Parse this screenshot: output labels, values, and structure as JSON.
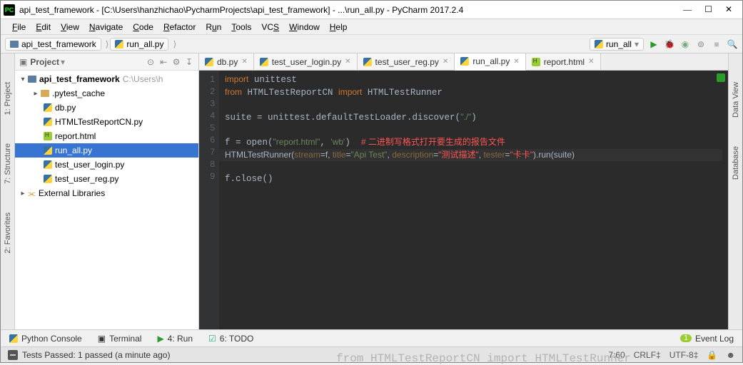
{
  "title": "api_test_framework - [C:\\Users\\hanzhichao\\PycharmProjects\\api_test_framework] - ...\\run_all.py - PyCharm 2017.2.4",
  "menu": [
    "File",
    "Edit",
    "View",
    "Navigate",
    "Code",
    "Refactor",
    "Run",
    "Tools",
    "VCS",
    "Window",
    "Help"
  ],
  "crumbs": {
    "root": "api_test_framework",
    "file": "run_all.py"
  },
  "run_config": "run_all",
  "left_rail": [
    "1: Project",
    "7: Structure",
    "2: Favorites"
  ],
  "right_rail": [
    "Data View",
    "Database"
  ],
  "project_panel_label": "Project",
  "tree": {
    "root": {
      "name": "api_test_framework",
      "path": "C:\\Users\\h"
    },
    "children": [
      {
        "name": ".pytest_cache",
        "kind": "dir"
      },
      {
        "name": "db.py",
        "kind": "py"
      },
      {
        "name": "HTMLTestReportCN.py",
        "kind": "py"
      },
      {
        "name": "report.html",
        "kind": "html"
      },
      {
        "name": "run_all.py",
        "kind": "py",
        "selected": true
      },
      {
        "name": "test_user_login.py",
        "kind": "py"
      },
      {
        "name": "test_user_reg.py",
        "kind": "py"
      }
    ],
    "ext_lib": "External Libraries"
  },
  "tabs": [
    {
      "name": "db.py",
      "kind": "py"
    },
    {
      "name": "test_user_login.py",
      "kind": "py"
    },
    {
      "name": "test_user_reg.py",
      "kind": "py"
    },
    {
      "name": "run_all.py",
      "kind": "py",
      "active": true
    },
    {
      "name": "report.html",
      "kind": "html"
    }
  ],
  "code_lines": [
    "1",
    "2",
    "3",
    "4",
    "5",
    "6",
    "7",
    "8",
    "9"
  ],
  "code": {
    "l1": "import unittest",
    "l2": "from HTMLTestReportCN import HTMLTestRunner",
    "l3": "",
    "l4": "suite = unittest.defaultTestLoader.discover(\"./\")",
    "l5": "",
    "l6a": "f = open(",
    "l6b": "\"report.html\"",
    "l6c": ", ",
    "l6d": "'wb'",
    "l6e": ")  ",
    "l6f": "# 二进制写格式打开要生成的报告文件",
    "l7a": "HTMLTestRunner(",
    "l7p1": "stream",
    "l7b": "=f, ",
    "l7p2": "title",
    "l7c": "=",
    "l7s1": "\"Api Test\"",
    "l7d": ", ",
    "l7p3": "description",
    "l7e": "=",
    "l7s2": "\"测试描述\"",
    "l7f": ", ",
    "l7p4": "tester",
    "l7g": "=",
    "l7s3": "\"卡卡\"",
    "l7h": ").run(suite)",
    "l8": "f.close()",
    "l9": ""
  },
  "bottombar": {
    "python_console": "Python Console",
    "terminal": "Terminal",
    "run": "4: Run",
    "todo": "6: TODO",
    "event_log": "Event Log",
    "event_count": "1"
  },
  "status": {
    "msg": "Tests Passed: 1 passed (a minute ago)",
    "pos": "7:60",
    "eol": "CRLF‡",
    "enc": "UTF-8‡"
  },
  "cutoff": "from HTMLTestReportCN import HTMLTestRunner"
}
